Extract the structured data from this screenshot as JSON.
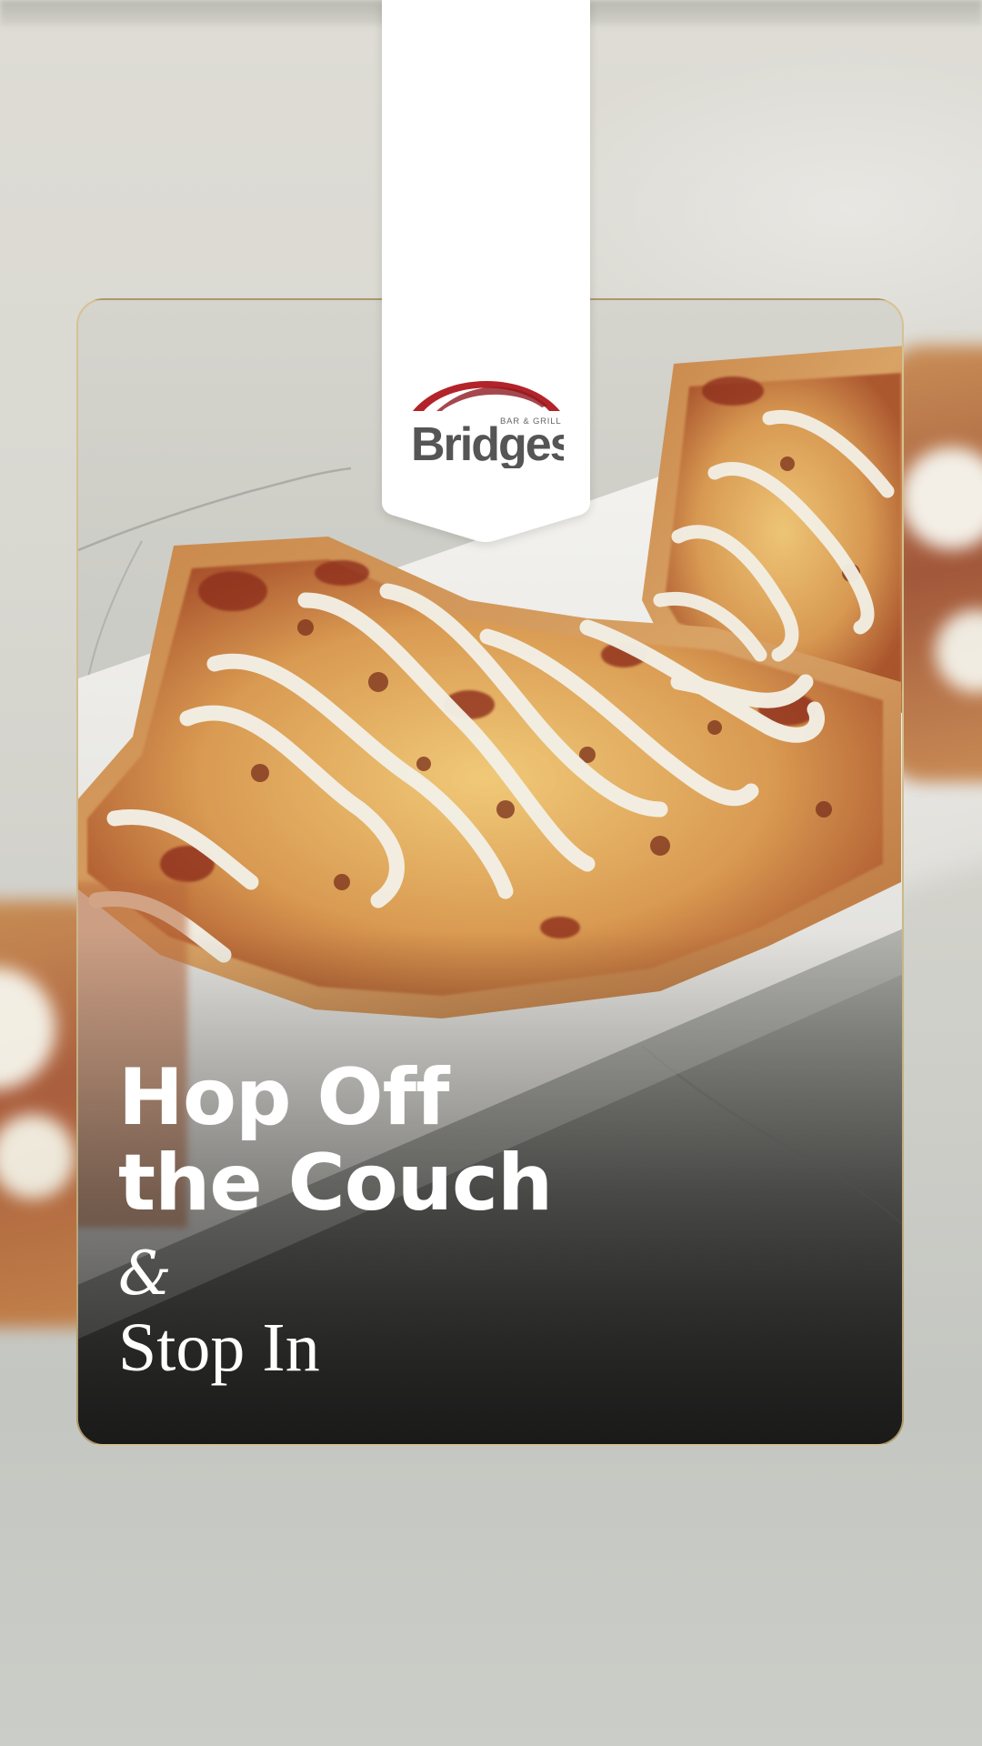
{
  "brand": {
    "name": "Bridges",
    "tagline": "BAR & GRILL",
    "colors": {
      "arch": "#b3232a",
      "wordmark": "#555555",
      "banner": "#ffffff",
      "card_border": "#d6bc80"
    }
  },
  "headline": {
    "line1": "Hop Off",
    "line2": "the Couch",
    "ampersand": "&",
    "line3": "Stop In"
  }
}
